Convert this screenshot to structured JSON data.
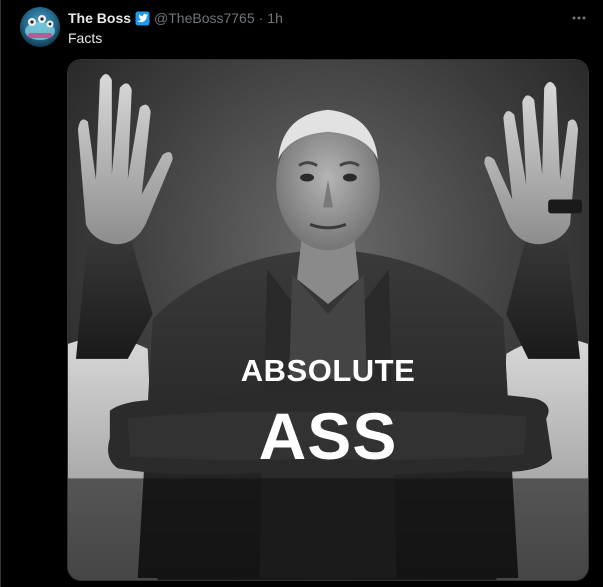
{
  "tweet": {
    "display_name": "The Boss",
    "handle": "@TheBoss7765",
    "separator": "·",
    "time": "1h",
    "text": "Facts",
    "more_icon": "more-dots-icon",
    "verified_icon": "verified-badge-icon"
  },
  "media": {
    "caption_line1": "ABSOLUTE",
    "caption_line2": "ASS"
  },
  "colors": {
    "background": "#000000",
    "text_primary": "#e7e9ea",
    "text_secondary": "#71767b",
    "verified_blue": "#1d9bf0",
    "border": "#2f3336"
  }
}
